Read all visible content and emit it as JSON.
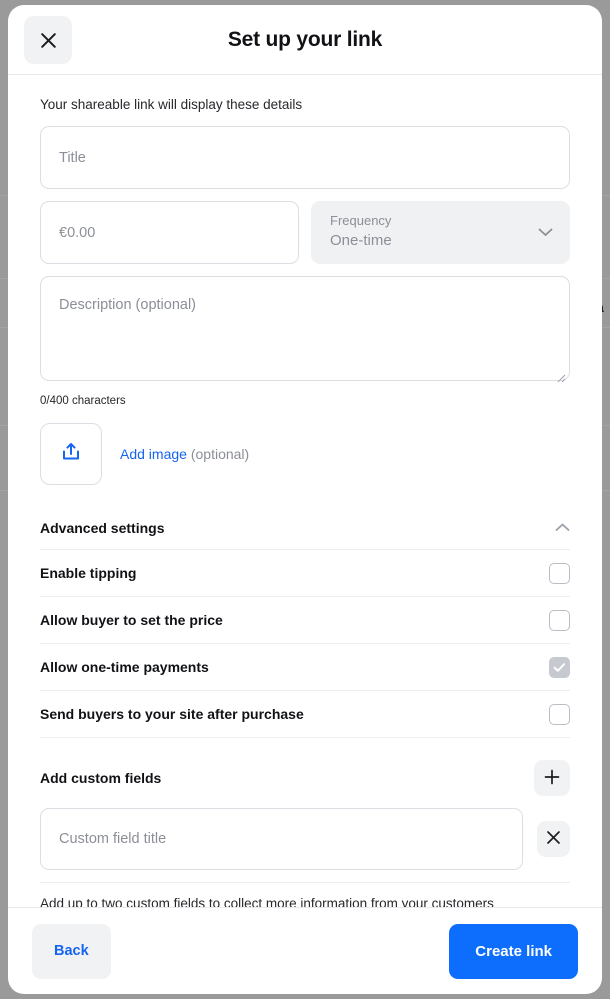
{
  "background": {
    "overlay_color": "#9a9a9a",
    "partial_text_right": "Sa"
  },
  "modal": {
    "title": "Set up your link",
    "close_icon": "close-icon",
    "intro": "Your shareable link will display these details",
    "form": {
      "title_field": {
        "value": "",
        "placeholder": "Title"
      },
      "price_field": {
        "value": "",
        "placeholder": "€0.00"
      },
      "frequency_select": {
        "label": "Frequency",
        "value": "One-time",
        "chevron_icon": "chevron-down-icon",
        "disabled": true
      },
      "description_field": {
        "value": "",
        "placeholder": "Description (optional)"
      },
      "char_count": "0/400 characters",
      "upload": {
        "icon": "upload-icon",
        "link_label": "Add image",
        "optional_label": "(optional)"
      }
    },
    "advanced_settings": {
      "title": "Advanced settings",
      "chevron_icon": "chevron-up-icon",
      "expanded": true,
      "toggles": [
        {
          "label": "Enable tipping",
          "checked": false,
          "disabled": false
        },
        {
          "label": "Allow buyer to set the price",
          "checked": false,
          "disabled": false
        },
        {
          "label": "Allow one-time payments",
          "checked": true,
          "disabled": true
        },
        {
          "label": "Send buyers to your site after purchase",
          "checked": false,
          "disabled": false
        }
      ]
    },
    "custom_fields": {
      "title": "Add custom fields",
      "add_icon": "plus-icon",
      "remove_icon": "close-icon",
      "input": {
        "value": "",
        "placeholder": "Custom field title"
      },
      "note": "Add up to two custom fields to collect more information from your customers"
    },
    "footer": {
      "back_label": "Back",
      "create_label": "Create link"
    }
  },
  "colors": {
    "accent_blue": "#0d6efd",
    "link_blue": "#1565f0",
    "text_dark": "#111215",
    "text_muted": "#8b8f97",
    "border": "#dcdee3",
    "chip_grey": "#f1f2f4"
  }
}
